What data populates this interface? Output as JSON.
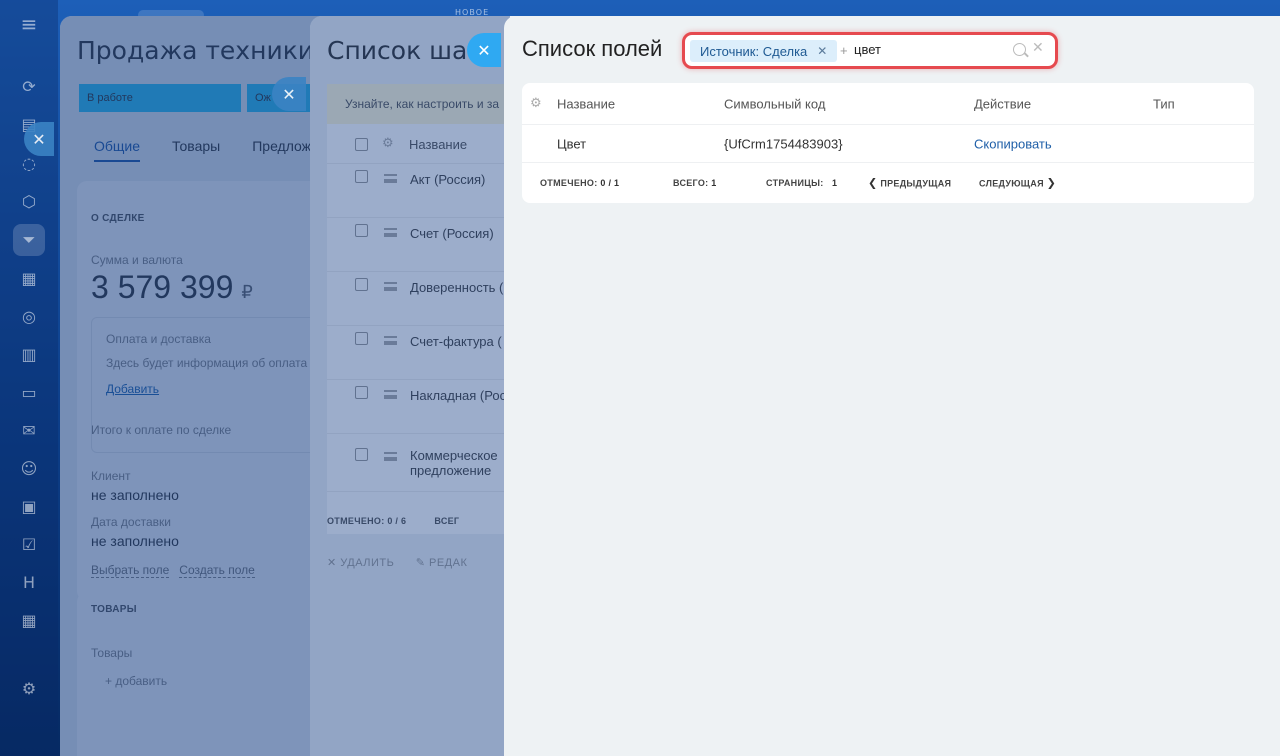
{
  "top_badge": "НОВОЕ",
  "deal": {
    "title": "Продажа техники Ряб",
    "stages": [
      "В работе",
      "Ож"
    ],
    "tabs": [
      "Общие",
      "Товары",
      "Предлож"
    ],
    "section_about": "О СДЕЛКЕ",
    "amount_label": "Сумма и валюта",
    "amount_value": "3 579 399",
    "currency": "₽",
    "payment_label": "Оплата и доставка",
    "payment_text": "Здесь будет информация об оплата",
    "add_link": "Добавить",
    "total_label": "Итого к оплате по сделке",
    "client_label": "Клиент",
    "client_value": "не заполнено",
    "delivery_label": "Дата доставки",
    "delivery_value": "не заполнено",
    "choose_field": "Выбрать поле",
    "create_field": "Создать поле",
    "section_goods": "ТОВАРЫ",
    "goods_label": "Товары",
    "goods_add": "+ добавить"
  },
  "templates": {
    "title": "Список шабл",
    "hint": "Узнайте, как настроить и за",
    "col_name": "Название",
    "rows": [
      "Акт (Россия)",
      "Счет (Россия)",
      "Доверенность (",
      "Счет-фактура (",
      "Накладная (Рос",
      "Коммерческое",
      "предложение"
    ],
    "footer": "ОТМЕЧЕНО: 0 / 6",
    "footer_total": "ВСЕГ",
    "delete": "УДАЛИТЬ",
    "edit": "РЕДАК"
  },
  "fields": {
    "title": "Список полей",
    "filter_chip": "Источник: Сделка",
    "search_value": "цвет",
    "columns": [
      "Название",
      "Символьный код",
      "Действие",
      "Тип"
    ],
    "rows": [
      {
        "name": "Цвет",
        "code": "{UfCrm1754483903}",
        "action": "Скопировать",
        "type": ""
      }
    ],
    "footer": {
      "selected_label": "ОТМЕЧЕНО:",
      "selected_value": "0 / 1",
      "total_label": "ВСЕГО:",
      "total_value": "1",
      "pages_label": "СТРАНИЦЫ:",
      "pages_value": "1",
      "prev": "ПРЕДЫДУЩАЯ",
      "next": "СЛЕДУЮЩАЯ"
    }
  },
  "colors": {
    "accent": "#2fa9f2",
    "highlight": "#e64a4f",
    "link": "#1f5fa8"
  }
}
